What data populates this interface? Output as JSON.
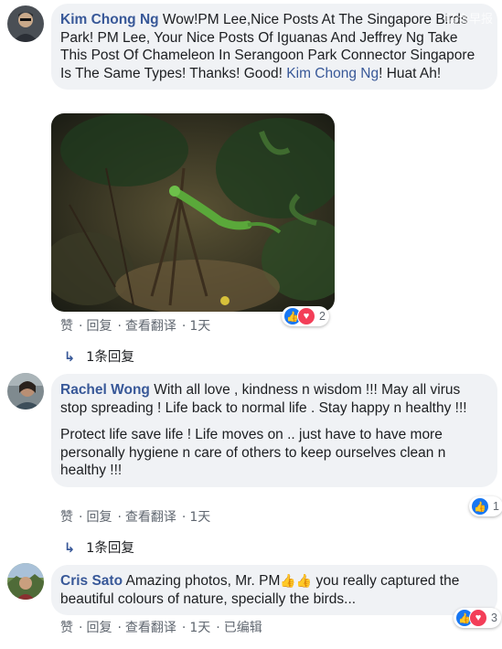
{
  "comments": [
    {
      "author": "Kim Chong Ng",
      "text": " Wow!PM Lee,Nice Posts At The Singapore Birds Park! PM Lee, Your Nice Posts Of Iguanas And Jeffrey Ng Take This Post Of Chameleon In Serangoon Park Connector Singapore Is The Same Types! Thanks! Good! ",
      "mention": "Kim Chong Ng",
      "text_after": "! Huat Ah!",
      "actions": {
        "like": "赞",
        "reply": "回复",
        "translate": "查看翻译",
        "time": "1天"
      },
      "reaction_count": "2",
      "replies": "1条回复"
    },
    {
      "author": "Rachel Wong",
      "text": " With all love , kindness n wisdom !!! May all virus stop spreading ! Life back to normal life . Stay happy n healthy !!!",
      "text2": "Protect life save life ! Life moves on .. just have to have more personally hygiene n care of others to keep ourselves clean n healthy !!!",
      "actions": {
        "like": "赞",
        "reply": "回复",
        "translate": "查看翻译",
        "time": "1天"
      },
      "reaction_count": "1",
      "replies": "1条回复"
    },
    {
      "author": "Cris Sato",
      "text_before": " Amazing photos, Mr. PM",
      "text_after": " you really captured the beautiful colours of nature, specially the birds...",
      "actions": {
        "like": "赞",
        "reply": "回复",
        "translate": "查看翻译",
        "time": "1天",
        "edited": "已编辑"
      },
      "reaction_count": "3"
    }
  ],
  "watermark": "联合早报",
  "colors": {
    "link": "#385898",
    "bubble": "#f0f2f5",
    "like": "#1877f2",
    "love": "#f33e58"
  }
}
